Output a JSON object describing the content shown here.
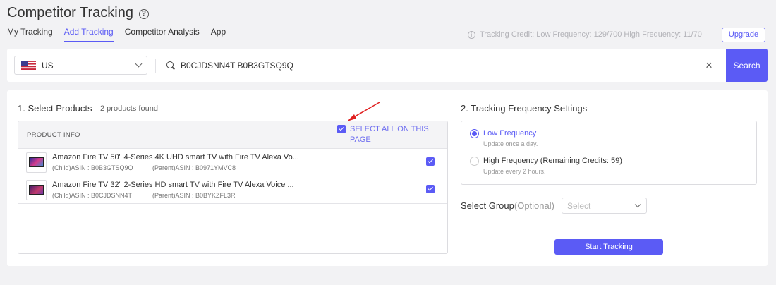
{
  "header": {
    "title": "Competitor Tracking",
    "help_glyph": "?",
    "tabs": [
      "My Tracking",
      "Add Tracking",
      "Competitor Analysis",
      "App"
    ],
    "active_tab": "Add Tracking",
    "credit_text": "Tracking Credit: Low Frequency: 129/700 High Frequency: 11/70",
    "upgrade_label": "Upgrade"
  },
  "search": {
    "country": "US",
    "query": "B0CJDSNN4T B0B3GTSQ9Q",
    "clear_glyph": "×",
    "button_label": "Search"
  },
  "products": {
    "section_title": "1. Select Products",
    "found_text": "2 products found",
    "column_header": "PRODUCT INFO",
    "select_all_label": "SELECT ALL ON THIS PAGE",
    "items": [
      {
        "name": "Amazon Fire TV 50\" 4-Series 4K UHD smart TV with Fire TV Alexa Vo...",
        "child_asin": "(Child)ASIN : B0B3GTSQ9Q",
        "parent_asin": "(Parent)ASIN : B0971YMVC8",
        "checked": true
      },
      {
        "name": "Amazon Fire TV 32\" 2-Series HD smart TV with Fire TV Alexa Voice ...",
        "child_asin": "(Child)ASIN : B0CJDSNN4T",
        "parent_asin": "(Parent)ASIN : B0BYKZFL3R",
        "checked": true
      }
    ]
  },
  "frequency": {
    "section_title": "2. Tracking Frequency Settings",
    "options": [
      {
        "label": "Low Frequency",
        "sub": "Update once a day.",
        "selected": true
      },
      {
        "label": "High Frequency (Remaining Credits: 59)",
        "sub": "Update every 2 hours.",
        "selected": false
      }
    ]
  },
  "group": {
    "label": "Select Group",
    "optional": "(Optional)",
    "placeholder": "Select"
  },
  "start_button_label": "Start Tracking",
  "colors": {
    "accent": "#5b5bf5",
    "annotation_arrow": "#e02020"
  }
}
